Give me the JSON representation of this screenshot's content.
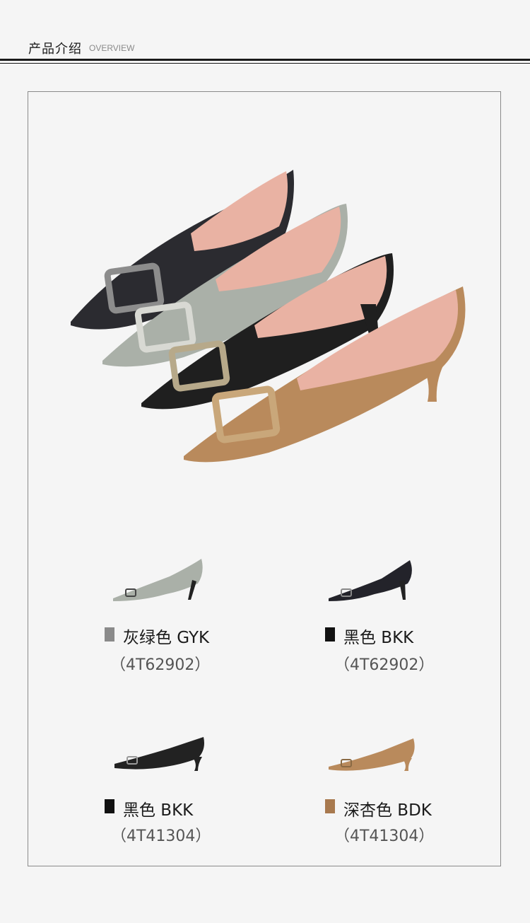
{
  "header": {
    "title": "产品介绍",
    "subtitle": "OVERVIEW"
  },
  "hero": {
    "shoe_colors": [
      "#2b2b30",
      "#aab0a8",
      "#1f1f1f",
      "#b98a5c"
    ],
    "buckle_colors": [
      "#8c8c8c",
      "#d8d9d3",
      "#b7a98a",
      "#c9a77a"
    ],
    "lining_color": "#e9b2a3"
  },
  "variants": [
    {
      "name": "灰绿色 GYK",
      "code": "（4T62902）",
      "swatch": "#8a8a8a",
      "shoe_color": "#aab0a8",
      "heel": "stiletto"
    },
    {
      "name": "黑色 BKK",
      "code": "（4T62902）",
      "swatch": "#111111",
      "shoe_color": "#23232a",
      "heel": "stiletto"
    },
    {
      "name": "黑色 BKK",
      "code": "（4T41304）",
      "swatch": "#111111",
      "shoe_color": "#222222",
      "heel": "kitten"
    },
    {
      "name": "深杏色 BDK",
      "code": "（4T41304）",
      "swatch": "#a8794e",
      "shoe_color": "#b98a5c",
      "heel": "kitten"
    }
  ]
}
